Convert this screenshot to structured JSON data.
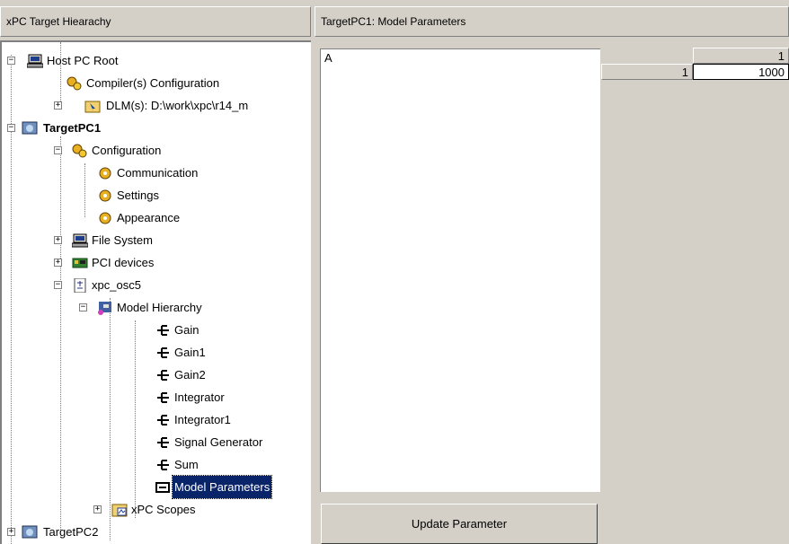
{
  "left_panel": {
    "title": "xPC Target Hiearachy"
  },
  "right_panel": {
    "title": "TargetPC1: Model Parameters"
  },
  "tree": {
    "host_root": "Host PC Root",
    "compiler_config": "Compiler(s) Configuration",
    "dlm": "DLM(s): D:\\work\\xpc\\r14_m",
    "target1": "TargetPC1",
    "configuration": "Configuration",
    "communication": "Communication",
    "settings": "Settings",
    "appearance": "Appearance",
    "file_system": "File System",
    "pci_devices": "PCI devices",
    "model": "xpc_osc5",
    "model_hierarchy": "Model Hierarchy",
    "blocks": [
      "Gain",
      "Gain1",
      "Gain2",
      "Integrator",
      "Integrator1",
      "Signal Generator",
      "Sum"
    ],
    "model_parameters": "Model Parameters",
    "xpc_scopes": "xPC Scopes",
    "target2": "TargetPC2"
  },
  "params": {
    "list": [
      "A"
    ],
    "col_header": "1",
    "row_header": "1",
    "value": "1000"
  },
  "update_button": "Update Parameter"
}
